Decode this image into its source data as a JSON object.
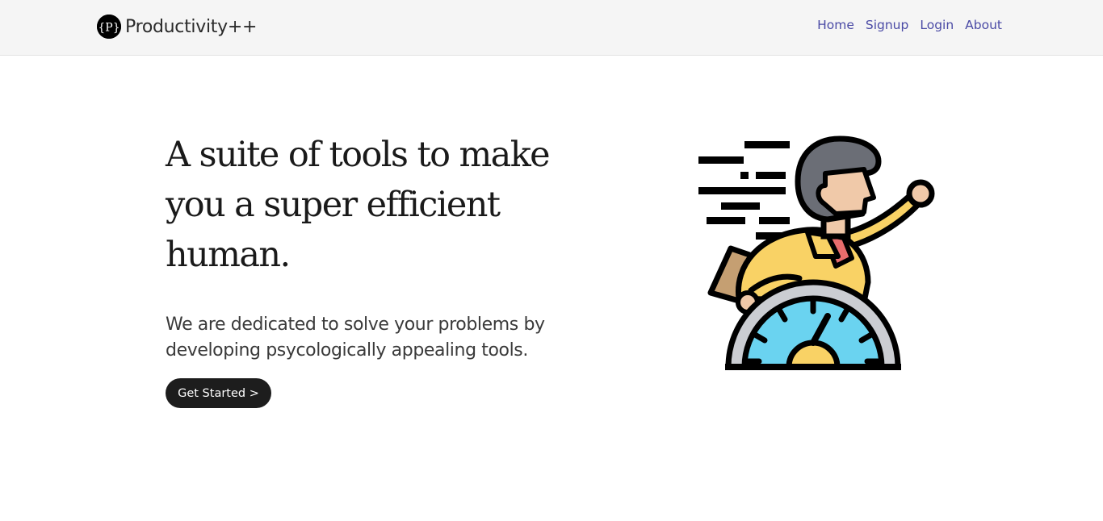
{
  "brand": {
    "logo_letter": "{P}",
    "name": "Productivity++"
  },
  "nav": {
    "items": [
      {
        "label": "Home"
      },
      {
        "label": "Signup"
      },
      {
        "label": "Login"
      },
      {
        "label": "About"
      }
    ]
  },
  "hero": {
    "title": "A suite of tools to make you a super efficient human.",
    "subtitle": "We are dedicated to solve your problems by developing psycologically appealing tools.",
    "cta_label": "Get Started >"
  },
  "illustration": {
    "icon": "productivity-speedometer-person-icon"
  },
  "colors": {
    "navbar_bg": "#f5f5f5",
    "nav_link": "#4a4aa5",
    "button_bg": "#1d1d1d",
    "gauge_blue": "#6ad3f0",
    "shirt_yellow": "#f9d265",
    "hair_gray": "#6b6e76",
    "skin": "#f0c9a9"
  }
}
